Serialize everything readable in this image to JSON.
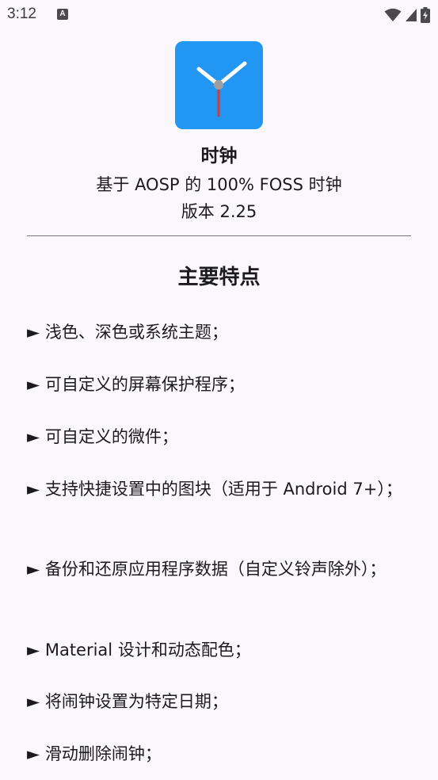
{
  "status_bar": {
    "time": "3:12",
    "notification_icon": "A",
    "icons": [
      "wifi-icon",
      "signal-icon",
      "battery-charging-icon"
    ]
  },
  "app": {
    "icon": "clock-icon",
    "icon_color": "#2196f3",
    "name": "时钟",
    "description": "基于 AOSP 的 100% FOSS 时钟",
    "version": "版本 2.25"
  },
  "features": {
    "title": "主要特点",
    "items": [
      "► 浅色、深色或系统主题；",
      "► 可自定义的屏幕保护程序；",
      "► 可自定义的微件；",
      "► 支持快捷设置中的图块（适用于 Android 7+）；",
      "► 备份和还原应用程序数据（自定义铃声除外）；",
      "► Material 设计和动态配色；",
      "► 将闹钟设置为特定日期；",
      "► 滑动删除闹钟；"
    ]
  }
}
